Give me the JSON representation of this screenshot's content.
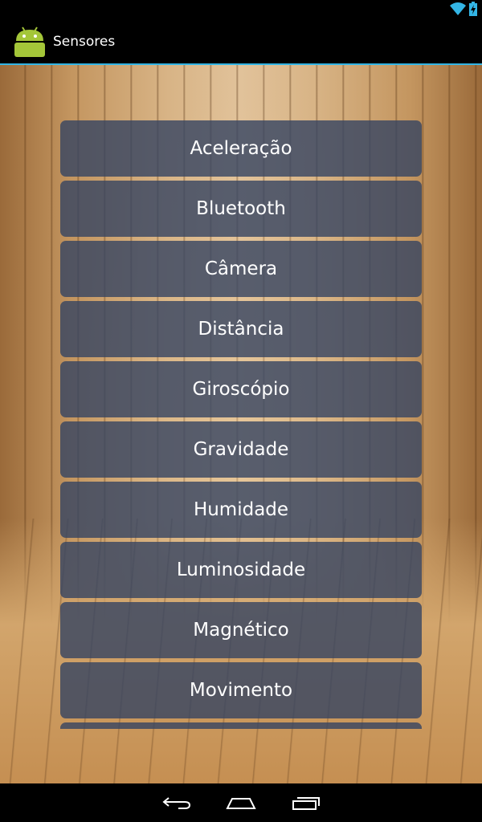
{
  "app": {
    "title": "Sensores"
  },
  "sensors": [
    {
      "label": "Aceleração"
    },
    {
      "label": "Bluetooth"
    },
    {
      "label": "Câmera"
    },
    {
      "label": "Distância"
    },
    {
      "label": "Giroscópio"
    },
    {
      "label": "Gravidade"
    },
    {
      "label": "Humidade"
    },
    {
      "label": "Luminosidade"
    },
    {
      "label": "Magnético"
    },
    {
      "label": "Movimento"
    }
  ],
  "icons": {
    "app": "android-icon",
    "wifi": "wifi-icon",
    "battery": "battery-charging-icon",
    "back": "back-icon",
    "home": "home-icon",
    "recent": "recent-apps-icon"
  },
  "colors": {
    "accent": "#33b5e5",
    "item_bg": "#344362",
    "android_green": "#a4c639"
  }
}
